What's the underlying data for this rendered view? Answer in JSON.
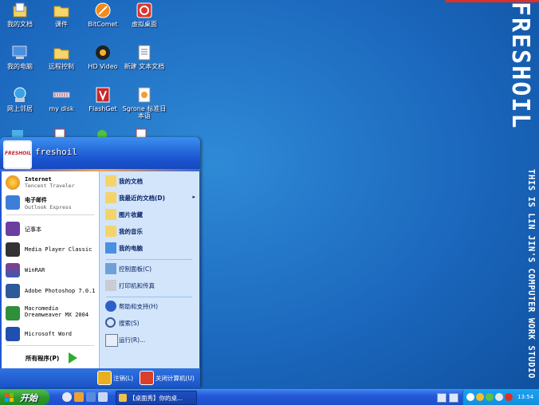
{
  "desktop": {
    "icons": [
      {
        "label": "我的文档",
        "icon": "my-documents-icon"
      },
      {
        "label": "课件",
        "icon": "folder-icon"
      },
      {
        "label": "BitComet",
        "icon": "bitcomet-icon"
      },
      {
        "label": "虚拟桌面",
        "icon": "virtual-desktop-icon"
      },
      {
        "label": "我的电脑",
        "icon": "my-computer-icon"
      },
      {
        "label": "远程控制",
        "icon": "folder-icon"
      },
      {
        "label": "HD Video",
        "icon": "hd-video-icon"
      },
      {
        "label": "新建 文本文档",
        "icon": "text-document-icon"
      },
      {
        "label": "网上邻居",
        "icon": "network-icon"
      },
      {
        "label": "my disk",
        "icon": "disk-icon"
      },
      {
        "label": "FlashGet",
        "icon": "flashget-icon"
      },
      {
        "label": "Sgrone 标准日本语",
        "icon": "japanese-app-icon"
      }
    ],
    "watermark_title": "FRESHOIL",
    "watermark_subtitle": "THIS IS LIN JIN'S COMPUTER WORK STUDIO"
  },
  "start_menu": {
    "avatar_text": "FRESHOIL",
    "user_name": "freshoil",
    "pinned": [
      {
        "title": "Internet",
        "subtitle": "Tencent Traveler",
        "icon": "browser-icon",
        "color": "#2a6fd6"
      },
      {
        "title": "电子邮件",
        "subtitle": "Outlook Express",
        "icon": "email-icon",
        "color": "#3c7fd9"
      }
    ],
    "recent": [
      {
        "title": "记事本",
        "icon": "notepad-icon",
        "color": "#6a3fa0"
      },
      {
        "title": "Media Player Classic",
        "icon": "media-player-icon",
        "color": "#333333"
      },
      {
        "title": "WinRAR",
        "icon": "winrar-icon",
        "color": "#8a3a8a"
      },
      {
        "title": "Adobe Photoshop 7.0.1",
        "icon": "photoshop-icon",
        "color": "#2d5a9a"
      },
      {
        "title": "Macromedia Dreamweaver MX 2004",
        "icon": "dreamweaver-icon",
        "color": "#2f8f3a"
      },
      {
        "title": "Microsoft Word",
        "icon": "word-icon",
        "color": "#1f4fb0"
      }
    ],
    "all_programs": "所有程序(P)",
    "right": [
      {
        "label": "我的文档",
        "icon": "my-documents-icon",
        "bold": true
      },
      {
        "label": "我最近的文档(D)",
        "icon": "recent-documents-icon",
        "bold": true,
        "arrow": "▸"
      },
      {
        "label": "图片收藏",
        "icon": "my-pictures-icon",
        "bold": true
      },
      {
        "label": "我的音乐",
        "icon": "my-music-icon",
        "bold": true
      },
      {
        "label": "我的电脑",
        "icon": "my-computer-icon",
        "bold": true
      },
      {
        "label": "控制面板(C)",
        "icon": "control-panel-icon",
        "bold": false
      },
      {
        "label": "打印机和传真",
        "icon": "printer-icon",
        "bold": false
      },
      {
        "label": "帮助和支持(H)",
        "icon": "help-icon",
        "bold": false
      },
      {
        "label": "搜索(S)",
        "icon": "search-icon",
        "bold": false
      },
      {
        "label": "运行(R)...",
        "icon": "run-icon",
        "bold": false
      }
    ],
    "logoff_label": "注销(L)",
    "shutdown_label": "关闭计算机(U)"
  },
  "taskbar": {
    "start_label": "开始",
    "task_label": "【桌面秀】你的桌...",
    "clock": "13:54"
  }
}
